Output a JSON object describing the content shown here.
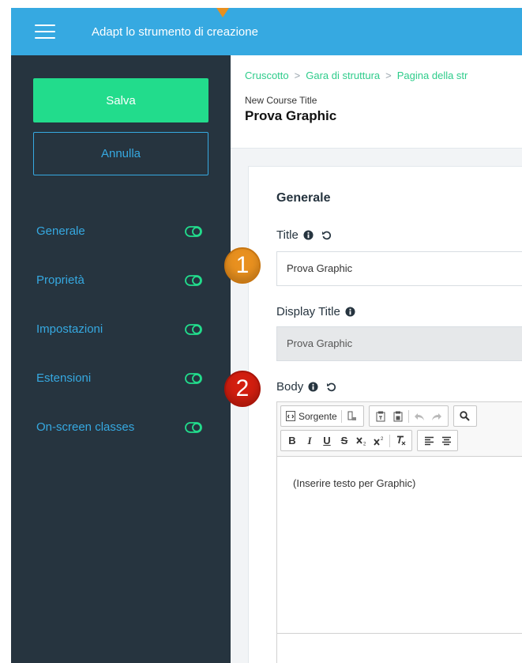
{
  "header": {
    "title": "Adapt lo strumento di creazione",
    "accent_color": "#36a9e1"
  },
  "sidebar": {
    "save_label": "Salva",
    "cancel_label": "Annulla",
    "items": [
      {
        "label": "Generale",
        "icon": "toggle-icon"
      },
      {
        "label": "Proprietà",
        "icon": "toggle-icon"
      },
      {
        "label": "Impostazioni",
        "icon": "toggle-icon"
      },
      {
        "label": "Estensioni",
        "icon": "toggle-icon"
      },
      {
        "label": "On-screen classes",
        "icon": "toggle-icon"
      }
    ],
    "save_color": "#22dc8c",
    "background": "#26343f"
  },
  "main": {
    "breadcrumb": [
      "Cruscotto",
      "Gara di struttura",
      "Pagina della str"
    ],
    "course_subtitle": "New Course Title",
    "course_title": "Prova Graphic",
    "section_title": "Generale",
    "fields": {
      "title": {
        "label": "Title",
        "value": "Prova Graphic"
      },
      "display_title": {
        "label": "Display Title",
        "value": "Prova Graphic"
      },
      "body": {
        "label": "Body",
        "content": "(Inserire testo per Graphic)"
      }
    },
    "editor": {
      "source_label": "Sorgente",
      "bold": "B",
      "italic": "I",
      "underline": "U",
      "strike": "S"
    }
  },
  "callouts": [
    "1",
    "2"
  ]
}
